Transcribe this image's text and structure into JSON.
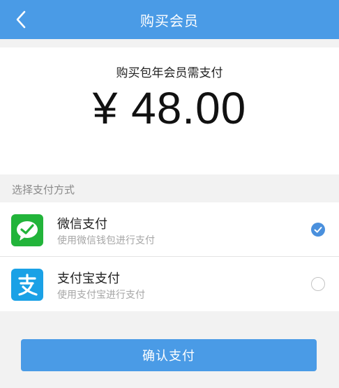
{
  "header": {
    "title": "购买会员",
    "back_icon": "chevron-left-icon"
  },
  "purchase": {
    "caption": "购买包年会员需支付",
    "amount": "¥ 48.00"
  },
  "payment": {
    "section_label": "选择支付方式",
    "methods": [
      {
        "name": "微信支付",
        "description": "使用微信钱包进行支付",
        "icon": "wechat-pay-icon",
        "icon_color": "#22b43a",
        "selected": true
      },
      {
        "name": "支付宝支付",
        "description": "使用支付宝进行支付",
        "icon": "alipay-icon",
        "icon_color": "#1aa1e6",
        "selected": false
      }
    ]
  },
  "confirm": {
    "label": "确认支付"
  },
  "colors": {
    "primary": "#4a9be6",
    "radio_checked": "#4a90dd",
    "background": "#f2f2f2"
  }
}
